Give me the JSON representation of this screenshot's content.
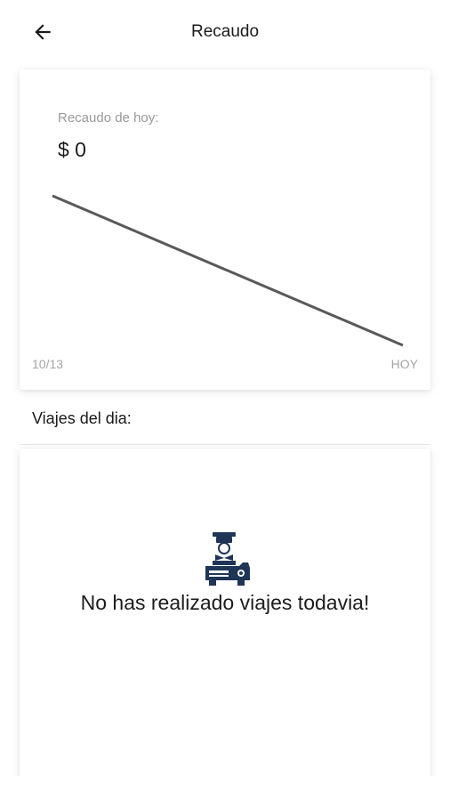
{
  "appbar": {
    "title": "Recaudo",
    "back_icon": "arrow-left-icon"
  },
  "earnings": {
    "label": "Recaudo de hoy:",
    "amount": "$ 0",
    "line_color": "#595959"
  },
  "chart_data": {
    "type": "line",
    "title": "",
    "xlabel": "",
    "ylabel": "",
    "categories": [
      "10/13",
      "HOY"
    ],
    "x_tick_labels": [
      "10/13",
      "HOY"
    ],
    "series": [
      {
        "values": [
          1,
          0
        ]
      }
    ],
    "grid": false
  },
  "trips": {
    "section_title": "Viajes del dia:",
    "empty_message": "No has realizado viajes todavia!",
    "empty_icon": "taxi-driver-icon",
    "icon_color": "#1f3556"
  }
}
